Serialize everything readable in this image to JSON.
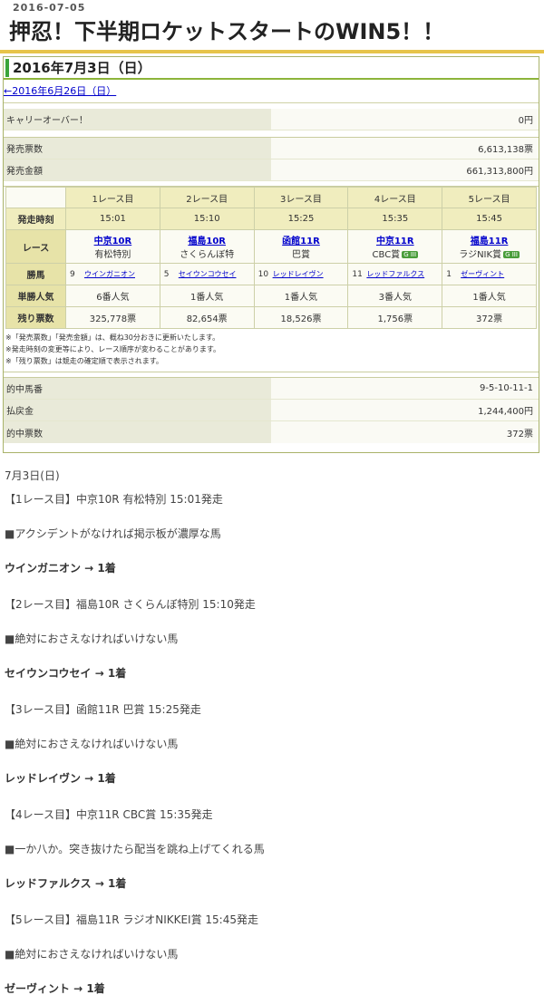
{
  "post": {
    "date": "2016-07-05",
    "title": "押忍！下半期ロケットスタートのWIN5！！"
  },
  "win5": {
    "day_heading": "2016年7月3日（日）",
    "prev_link": "←2016年6月26日（日）",
    "carryover": {
      "label": "キャリーオーバー！",
      "value": "0円"
    },
    "sales": [
      {
        "label": "発売票数",
        "value": "6,613,138票"
      },
      {
        "label": "発売金額",
        "value": "661,313,800円"
      }
    ],
    "race_headers": [
      "1レース目",
      "2レース目",
      "3レース目",
      "4レース目",
      "5レース目"
    ],
    "row_labels": {
      "time": "発走時刻",
      "race": "レース",
      "winner": "勝馬",
      "popularity": "単勝人気",
      "remaining": "残り票数"
    },
    "races": [
      {
        "time": "15:01",
        "course": "中京10R",
        "name": "有松特別",
        "grade": "",
        "horse_no": "9",
        "horse": "ウインガニオン",
        "popularity": "6番人気",
        "remaining": "325,778票"
      },
      {
        "time": "15:10",
        "course": "福島10R",
        "name": "さくらんぼ特",
        "grade": "",
        "horse_no": "5",
        "horse": "セイウンコウセイ",
        "popularity": "1番人気",
        "remaining": "82,654票"
      },
      {
        "time": "15:25",
        "course": "函館11R",
        "name": "巴賞",
        "grade": "",
        "horse_no": "10",
        "horse": "レッドレイヴン",
        "popularity": "1番人気",
        "remaining": "18,526票"
      },
      {
        "time": "15:35",
        "course": "中京11R",
        "name": "CBC賞",
        "grade": "G III",
        "horse_no": "11",
        "horse": "レッドファルクス",
        "popularity": "3番人気",
        "remaining": "1,756票"
      },
      {
        "time": "15:45",
        "course": "福島11R",
        "name": "ラジNIK賞",
        "grade": "G III",
        "horse_no": "1",
        "horse": "ゼーヴィント",
        "popularity": "1番人気",
        "remaining": "372票"
      }
    ],
    "notes": [
      "※「発売票数」「発売金額」は、概ね30分おきに更新いたします。",
      "※発走時刻の変更等により、レース順序が変わることがあります。",
      "※「残り票数」は競走の確定順で表示されます。"
    ],
    "results": [
      {
        "label": "的中馬番",
        "value": "9-5-10-11-1"
      },
      {
        "label": "払戻金",
        "value": "1,244,400円"
      },
      {
        "label": "的中票数",
        "value": "372票"
      }
    ]
  },
  "article": {
    "date_line": "7月3日(日)",
    "entries": [
      {
        "race": "【1レース目】中京10R 有松特別 15:01発走",
        "comment": "■アクシデントがなければ掲示板が濃厚な馬",
        "result": "ウインガニオン → 1着"
      },
      {
        "race": "【2レース目】福島10R さくらんぼ特別 15:10発走",
        "comment": "■絶対におさえなければいけない馬",
        "result": "セイウンコウセイ → 1着"
      },
      {
        "race": "【3レース目】函館11R 巴賞 15:25発走",
        "comment": "■絶対におさえなければいけない馬",
        "result": "レッドレイヴン → 1着"
      },
      {
        "race": "【4レース目】中京11R CBC賞 15:35発走",
        "comment": "■一か八か。突き抜けたら配当を跳ね上げてくれる馬",
        "result": "レッドファルクス → 1着"
      },
      {
        "race": "【5レース目】福島11R ラジオNIKKEI賞 15:45発走",
        "comment": "■絶対におさえなければいけない馬",
        "result": "ゼーヴィント → 1着"
      }
    ]
  }
}
